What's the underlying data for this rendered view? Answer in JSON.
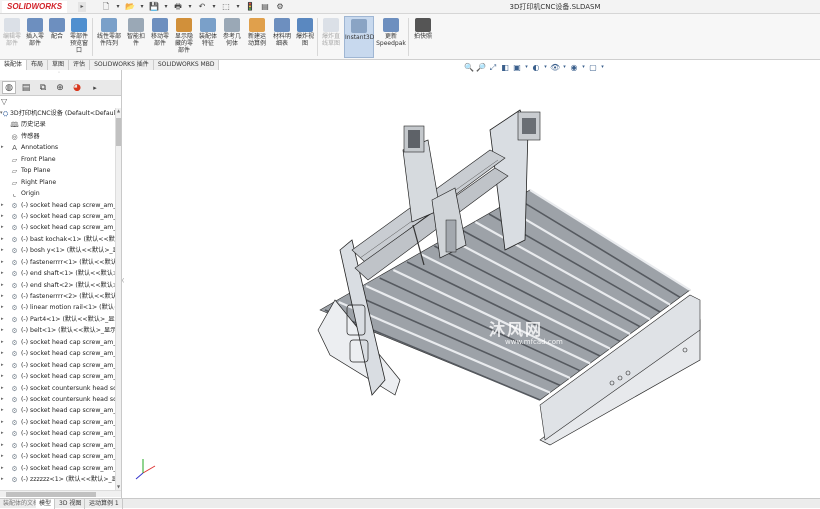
{
  "app": {
    "logo_text": "SOLIDWORKS",
    "document_title": "3D打印机CNC设备.SLDASM"
  },
  "quick_access": {
    "icons": [
      "new-icon",
      "open-icon",
      "save-icon",
      "print-icon",
      "undo-icon",
      "select-icon",
      "rebuild-icon",
      "file-properties-icon",
      "options-icon"
    ],
    "glyphs": [
      "🗋",
      "▾",
      "📂",
      "▾",
      "💾",
      "▾",
      "🖶",
      "▾",
      "↶",
      "▾",
      "⬚",
      "▾",
      "🚦",
      "▤",
      "⚙"
    ]
  },
  "ribbon": {
    "buttons": [
      {
        "id": "edit-component",
        "label": "编辑零\n部件",
        "dim": true
      },
      {
        "id": "insert-component",
        "label": "插入零\n部件"
      },
      {
        "id": "mate",
        "label": "配合"
      },
      {
        "id": "component-preview",
        "label": "零部件\n预览窗\n口"
      },
      {
        "id": "linear-pattern",
        "label": "线性零部\n件阵列"
      },
      {
        "id": "smart-fasteners",
        "label": "智能扣\n件"
      },
      {
        "id": "move-component",
        "label": "移动零\n部件"
      },
      {
        "id": "show-hidden",
        "label": "显示隐\n藏的零\n部件"
      },
      {
        "id": "assembly-features",
        "label": "装配体\n特征"
      },
      {
        "id": "reference-geometry",
        "label": "参考几\n何体"
      },
      {
        "id": "new-motion-study",
        "label": "新建运\n动算例"
      },
      {
        "id": "bom",
        "label": "材料明\n细表"
      },
      {
        "id": "exploded-view",
        "label": "爆炸视\n图"
      },
      {
        "id": "explode-line-sketch",
        "label": "爆炸直\n线草图",
        "dim": true
      },
      {
        "id": "instant3d",
        "label": "Instant3D",
        "active": true
      },
      {
        "id": "update-speedpak",
        "label": "更新\nSpeedpak"
      },
      {
        "id": "take-snapshot",
        "label": "拍快照"
      }
    ]
  },
  "command_tabs": [
    "装配体",
    "布局",
    "草图",
    "评估",
    "SOLIDWORKS 插件",
    "SOLIDWORKS MBD"
  ],
  "heads_up_toolbar": {
    "glyphs": [
      "🔍",
      "🔎",
      "⤢",
      "◧",
      "▣",
      "▾",
      "◐",
      "▾",
      "👁",
      "▾",
      "◉",
      "▾",
      "▢",
      "▾"
    ]
  },
  "panel": {
    "tabs": [
      "feature-manager",
      "property-manager",
      "configuration-manager",
      "dimxpert-manager",
      "display-manager"
    ],
    "filter_glyph": "▽",
    "tree": [
      {
        "label": "3D打印机CNC设备  (Default<Defaul",
        "icon": "assembly",
        "level": 0,
        "twisty": "▾"
      },
      {
        "label": "历史记录",
        "icon": "history",
        "level": 1
      },
      {
        "label": "传感器",
        "icon": "sensor",
        "level": 1
      },
      {
        "label": "Annotations",
        "icon": "annotation",
        "level": 1,
        "twisty": "▸"
      },
      {
        "label": "Front Plane",
        "icon": "plane",
        "level": 1
      },
      {
        "label": "Top Plane",
        "icon": "plane",
        "level": 1
      },
      {
        "label": "Right Plane",
        "icon": "plane",
        "level": 1
      },
      {
        "label": "Origin",
        "icon": "origin",
        "level": 1
      },
      {
        "label": "(-) socket head cap screw_am_",
        "icon": "part",
        "level": 1,
        "twisty": "▸"
      },
      {
        "label": "(-) socket head cap screw_am_",
        "icon": "part",
        "level": 1,
        "twisty": "▸"
      },
      {
        "label": "(-) socket head cap screw_am_",
        "icon": "part",
        "level": 1,
        "twisty": "▸"
      },
      {
        "label": "(-) bast kochak<1> (默认<<默",
        "icon": "part",
        "level": 1,
        "twisty": "▸"
      },
      {
        "label": "(-) bosh y<1> (默认<<默认>_显",
        "icon": "part",
        "level": 1,
        "twisty": "▸"
      },
      {
        "label": "(-) fastenerrrr<1> (默认<<默认",
        "icon": "part",
        "level": 1,
        "twisty": "▸"
      },
      {
        "label": "(-) end shaft<1> (默认<<默认>_",
        "icon": "part",
        "level": 1,
        "twisty": "▸"
      },
      {
        "label": "(-) end shaft<2> (默认<<默认>_",
        "icon": "part",
        "level": 1,
        "twisty": "▸"
      },
      {
        "label": "(-) fastenerrrr<2> (默认<<默认",
        "icon": "part",
        "level": 1,
        "twisty": "▸"
      },
      {
        "label": "(-) linear motion rail<1> (默认<",
        "icon": "part",
        "level": 1,
        "twisty": "▸"
      },
      {
        "label": "(-) Part4<1> (默认<<默认>_显示",
        "icon": "part",
        "level": 1,
        "twisty": "▸"
      },
      {
        "label": "(-) belt<1> (默认<<默认>_显示",
        "icon": "part",
        "level": 1,
        "twisty": "▸"
      },
      {
        "label": "(-) socket head cap screw_am_",
        "icon": "part",
        "level": 1,
        "twisty": "▸"
      },
      {
        "label": "(-) socket head cap screw_am_",
        "icon": "part",
        "level": 1,
        "twisty": "▸"
      },
      {
        "label": "(-) socket head cap screw_am_",
        "icon": "part",
        "level": 1,
        "twisty": "▸"
      },
      {
        "label": "(-) socket head cap screw_am_",
        "icon": "part",
        "level": 1,
        "twisty": "▸"
      },
      {
        "label": "(-) socket countersunk head sc",
        "icon": "part",
        "level": 1,
        "twisty": "▸"
      },
      {
        "label": "(-) socket countersunk head sc",
        "icon": "part",
        "level": 1,
        "twisty": "▸"
      },
      {
        "label": "(-) socket head cap screw_am_",
        "icon": "part",
        "level": 1,
        "twisty": "▸"
      },
      {
        "label": "(-) socket head cap screw_am_",
        "icon": "part",
        "level": 1,
        "twisty": "▸"
      },
      {
        "label": "(-) socket head cap screw_am_",
        "icon": "part",
        "level": 1,
        "twisty": "▸"
      },
      {
        "label": "(-) socket head cap screw_am_",
        "icon": "part",
        "level": 1,
        "twisty": "▸"
      },
      {
        "label": "(-) socket head cap screw_am_",
        "icon": "part",
        "level": 1,
        "twisty": "▸"
      },
      {
        "label": "(-) socket head cap screw_am_",
        "icon": "part",
        "level": 1,
        "twisty": "▸"
      },
      {
        "label": "(-) zzzzzz<1> (默认<<默认>_显示",
        "icon": "part",
        "level": 1,
        "twisty": "▸"
      }
    ]
  },
  "bottom_tabs": [
    "模型",
    "3D 视图",
    "运动算例 1"
  ],
  "bottom_left_text": "装配体的文档",
  "viewport": {
    "watermark": "沐风网",
    "watermark_url": "www.mfcad.com",
    "triad_axes": [
      "x",
      "y",
      "z"
    ]
  },
  "colors": {
    "accent": "#c8d9ee",
    "brand_red": "#d2232a",
    "part_fill": "#d9dde2",
    "rail_dark": "#55595f"
  }
}
